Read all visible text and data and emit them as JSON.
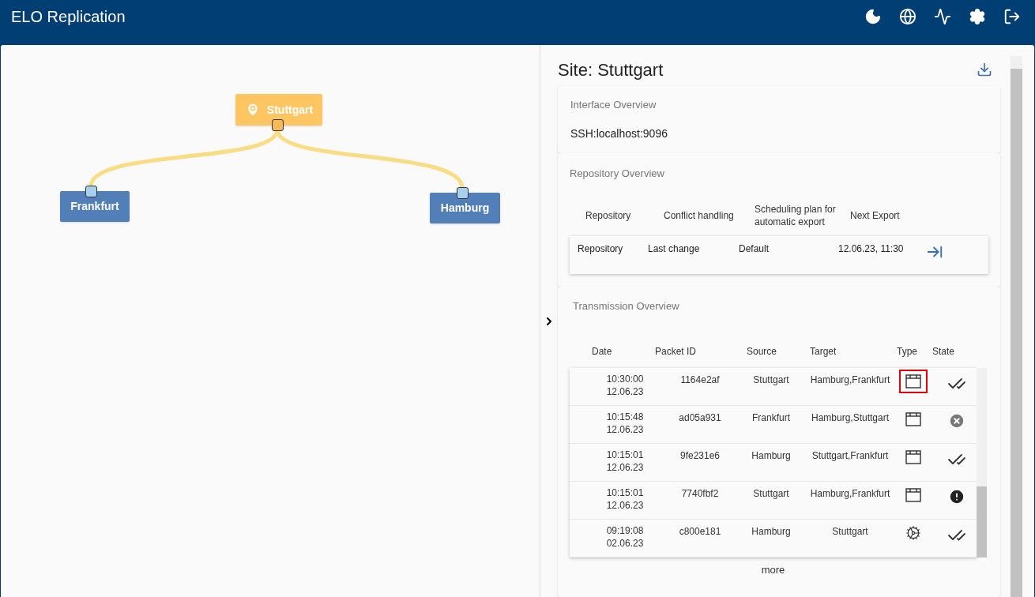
{
  "app": {
    "title": "ELO Replication"
  },
  "diagram": {
    "nodes": [
      {
        "label": "Stuttgart",
        "kind": "source"
      },
      {
        "label": "Frankfurt",
        "kind": "target"
      },
      {
        "label": "Hamburg",
        "kind": "target"
      }
    ]
  },
  "panel": {
    "title": "Site: Stuttgart",
    "interface": {
      "title": "Interface Overview",
      "value": "SSH:localhost:9096"
    },
    "repository": {
      "title": "Repository Overview",
      "columns": [
        "Repository",
        "Conflict handling",
        "Scheduling plan for automatic export",
        "Next Export"
      ],
      "rows": [
        [
          "Repository",
          "Last change",
          "Default",
          "12.06.23, 11:30"
        ]
      ]
    },
    "transmission": {
      "title": "Transmission Overview",
      "columns": [
        "Date",
        "Packet ID",
        "Source",
        "Target",
        "Type",
        "State"
      ],
      "rows": [
        {
          "time": "10:30:00",
          "date": "12.06.23",
          "id": "1164e2af",
          "source": "Stuttgart",
          "target": "Hamburg,Frankfurt",
          "type": {
            "kind": "package"
          },
          "selected": true,
          "state": {
            "kind": "done"
          }
        },
        {
          "time": "10:15:48",
          "date": "12.06.23",
          "id": "ad05a931",
          "source": "Frankfurt",
          "target": "Hamburg,Stuttgart",
          "type": {
            "kind": "package"
          },
          "selected": false,
          "state": {
            "kind": "failed"
          }
        },
        {
          "time": "10:15:01",
          "date": "12.06.23",
          "id": "9fe231e6",
          "source": "Hamburg",
          "target": "Stuttgart,Frankfurt",
          "type": {
            "kind": "package"
          },
          "selected": false,
          "state": {
            "kind": "done"
          }
        },
        {
          "time": "10:15:01",
          "date": "12.06.23",
          "id": "7740fbf2",
          "source": "Stuttgart",
          "target": "Hamburg,Frankfurt",
          "type": {
            "kind": "package"
          },
          "selected": false,
          "state": {
            "kind": "warning"
          }
        },
        {
          "time": "09:19:08",
          "date": "02.06.23",
          "id": "c800e181",
          "source": "Hamburg",
          "target": "Stuttgart",
          "type": {
            "kind": "config"
          },
          "selected": false,
          "state": {
            "kind": "done"
          }
        }
      ],
      "more": "more"
    }
  }
}
